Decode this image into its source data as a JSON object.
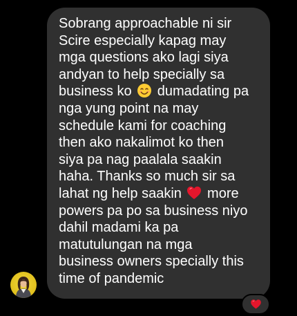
{
  "message": {
    "lines": [
      "Sobrang approachable ni sir",
      "Scire especially kapag may",
      "mga questions ako lagi siya",
      "andyan to help specially sa",
      "business ko",
      "dumadating pa",
      "nga yung point na may",
      "schedule kami for coaching",
      "then ako nakalimot ko then",
      "siya pa nag paalala saakin",
      "haha. Thanks so much sir sa",
      "lahat ng help saakin",
      "more",
      "powers pa po sa business niyo",
      "dahil madami ka pa",
      "matutulungan na mga",
      "business owners specially this",
      "time of pandemic"
    ],
    "emojis": {
      "smile": "smiling-face-emoji",
      "heart": "red-heart-emoji"
    }
  },
  "avatar": {
    "icon": "sender-avatar"
  },
  "reaction": {
    "icon": "heart-reaction-icon",
    "color": "#e4162c"
  },
  "colors": {
    "background": "#000000",
    "bubble": "#303030",
    "text": "#ffffff",
    "heart": "#e4162c"
  }
}
